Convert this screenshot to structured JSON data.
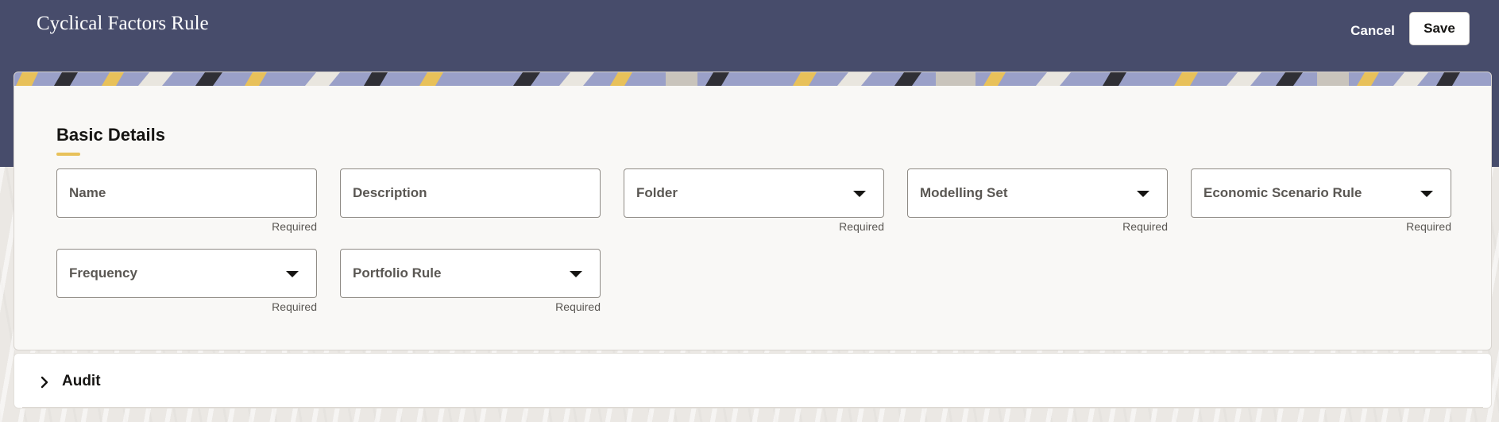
{
  "header": {
    "title": "Cyclical Factors Rule",
    "cancel_label": "Cancel",
    "save_label": "Save"
  },
  "section": {
    "title": "Basic Details"
  },
  "fields": {
    "name": {
      "label": "Name",
      "hint": "Required"
    },
    "description": {
      "label": "Description"
    },
    "folder": {
      "label": "Folder",
      "hint": "Required"
    },
    "modelling_set": {
      "label": "Modelling Set",
      "hint": "Required"
    },
    "economic_scenario_rule": {
      "label": "Economic Scenario Rule",
      "hint": "Required"
    },
    "frequency": {
      "label": "Frequency",
      "hint": "Required"
    },
    "portfolio_rule": {
      "label": "Portfolio Rule",
      "hint": "Required"
    }
  },
  "audit": {
    "title": "Audit"
  },
  "colors": {
    "header_band": "#474c6b",
    "accent_underline": "#e8c15a"
  },
  "icons": {
    "dropdown": "chevron-down-icon",
    "expand": "chevron-right-icon"
  }
}
